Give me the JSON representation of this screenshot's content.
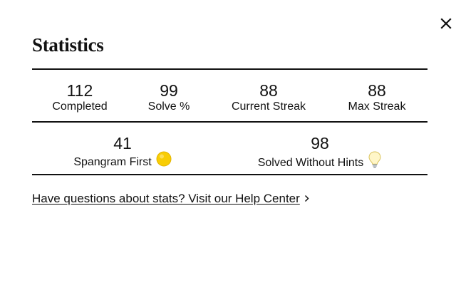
{
  "modal": {
    "title": "Statistics",
    "close_icon": "close-icon"
  },
  "stats": {
    "completed": {
      "value": "112",
      "label": "Completed"
    },
    "solve_pct": {
      "value": "99",
      "label": "Solve %"
    },
    "current_streak": {
      "value": "88",
      "label": "Current Streak"
    },
    "max_streak": {
      "value": "88",
      "label": "Max Streak"
    },
    "spangram_first": {
      "value": "41",
      "label": "Spangram First",
      "icon": "yellow-circle-icon"
    },
    "solved_without_hints": {
      "value": "98",
      "label": "Solved Without Hints",
      "icon": "lightbulb-icon"
    }
  },
  "help": {
    "link_text": "Have questions about stats? Visit our Help Center",
    "chevron_icon": "chevron-right-icon"
  },
  "colors": {
    "text": "#121212",
    "background": "#ffffff",
    "spangram_yellow": "#f8cd05"
  }
}
